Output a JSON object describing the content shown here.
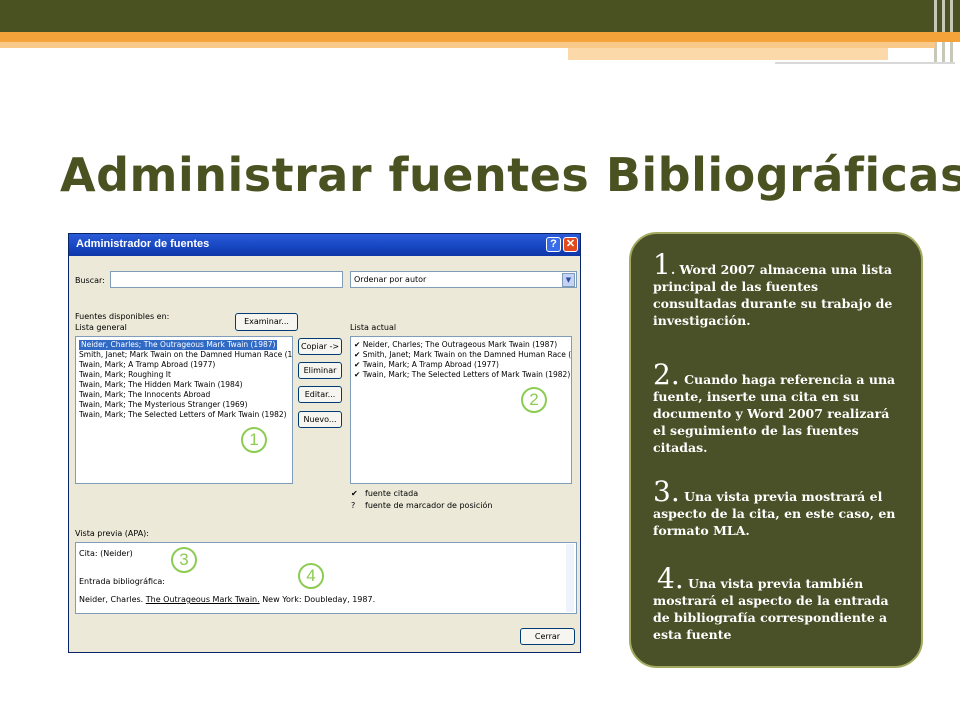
{
  "slide": {
    "title": "Administrar fuentes Bibliográficas"
  },
  "dialog": {
    "title": "Administrador de fuentes",
    "help_label": "?",
    "close_label": "✕",
    "search_label": "Buscar:",
    "search_value": "",
    "sort_value": "Ordenar por autor",
    "sources_available_label": "Fuentes disponibles en:",
    "general_list_label": "Lista general",
    "browse_button": "Examinar...",
    "current_list_label": "Lista actual",
    "general_list": [
      "Neider, Charles; The Outrageous Mark Twain (1987)",
      "Smith, Janet; Mark Twain on the Damned Human Race (1",
      "Twain, Mark; A Tramp Abroad (1977)",
      "Twain, Mark; Roughing It",
      "Twain, Mark; The Hidden Mark Twain (1984)",
      "Twain, Mark; The Innocents Abroad",
      "Twain, Mark; The Mysterious Stranger (1969)",
      "Twain, Mark; The Selected Letters of Mark Twain (1982)"
    ],
    "current_list": [
      "Neider, Charles; The Outrageous Mark Twain (1987)",
      "Smith, Janet; Mark Twain on the Damned Human Race (1",
      "Twain, Mark; A Tramp Abroad (1977)",
      "Twain, Mark; The Selected Letters of Mark Twain (1982)"
    ],
    "check_mark": "✔",
    "buttons": {
      "copy": "Copiar ->",
      "delete": "Eliminar",
      "edit": "Editar...",
      "new": "Nuevo...",
      "close": "Cerrar"
    },
    "legend": {
      "cited_symbol": "✔",
      "cited_label": "fuente citada",
      "placeholder_symbol": "?",
      "placeholder_label": "fuente de marcador de posición"
    },
    "preview_label": "Vista previa (APA):",
    "preview": {
      "citation": "Cita: (Neider)",
      "bib_label": "Entrada bibliográfica:",
      "bib_author": "Neider, Charles. ",
      "bib_title": "The Outrageous Mark Twain.",
      "bib_rest": " New York: Doubleday, 1987."
    },
    "callouts": [
      "1",
      "2",
      "3",
      "4"
    ]
  },
  "panel": {
    "items": [
      {
        "num": "1",
        "text": ". Word 2007 almacena una lista principal de las fuentes consultadas durante su trabajo de investigación."
      },
      {
        "num": "2.",
        "text": " Cuando haga referencia a una fuente, inserte una cita en su documento y Word 2007 realizará el seguimiento de las fuentes citadas."
      },
      {
        "num": "3.",
        "text": " Una vista previa mostrará el aspecto de la cita, en este caso, en formato MLA."
      },
      {
        "num": "4.",
        "text": " Una vista previa también mostrará el aspecto de la entrada de bibliografía correspondiente a esta fuente"
      }
    ]
  },
  "colors": {
    "olive": "#4a5221",
    "orange": "#f4a23a",
    "callout_green": "#8ccc52"
  }
}
